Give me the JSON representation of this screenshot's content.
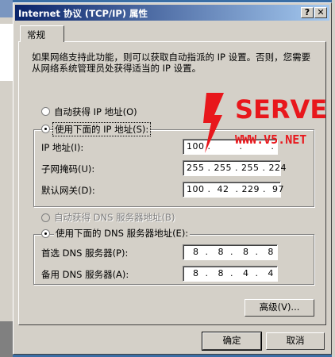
{
  "window": {
    "title": "Internet 协议 (TCP/IP) 属性",
    "help_button": "?",
    "close_button": "✕"
  },
  "tabs": [
    "常规"
  ],
  "description": "如果网络支持此功能，则可以获取自动指派的 IP 设置。否则，您需要从网络系统管理员处获得适当的 IP 设置。",
  "ip_section": {
    "auto_label": "自动获得 IP 地址(O)",
    "manual_label": "使用下面的 IP 地址(S):",
    "selected": "manual",
    "fields": [
      {
        "label": "IP 地址(I):",
        "value": "100 .         .         ."
      },
      {
        "label": "子网掩码(U):",
        "value": "255 . 255 . 255 . 224"
      },
      {
        "label": "默认网关(D):",
        "value": "100 .  42  . 229 .  97"
      }
    ]
  },
  "dns_section": {
    "auto_label": "自动获得 DNS 服务器地址(B)",
    "manual_label": "使用下面的 DNS 服务器地址(E):",
    "selected": "manual",
    "fields": [
      {
        "label": "首选 DNS 服务器(P):",
        "value": "  8  .   8  .   8  .   8"
      },
      {
        "label": "备用 DNS 服务器(A):",
        "value": "  8  .   8  .   4  .   4"
      }
    ]
  },
  "advanced_button": "高级(V)...",
  "ok_button": "确定",
  "cancel_button": "取消",
  "watermark": {
    "brand": "SERVER",
    "url": "WWW.V5.NET",
    "color": "#e8171c"
  }
}
